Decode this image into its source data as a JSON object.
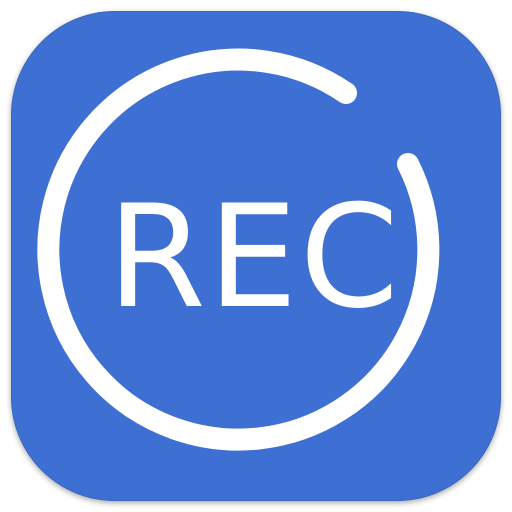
{
  "icon": {
    "label": "REC",
    "name": "record-icon",
    "background_color": "#3e6fd3",
    "foreground_color": "#ffffff"
  }
}
